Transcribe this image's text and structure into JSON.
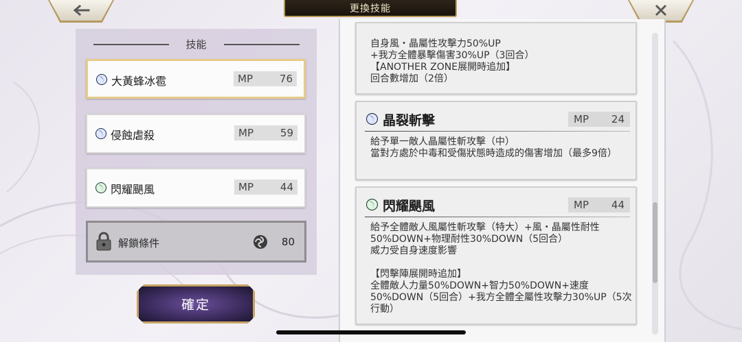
{
  "header": {
    "title": "更換技能",
    "back_icon": "back-arrow-icon",
    "close_icon": "close-icon"
  },
  "skills_panel": {
    "title": "技能",
    "skills": [
      {
        "name": "大黃蜂冰雹",
        "mp_label": "MP",
        "mp": "76",
        "icon": "crescent-slash-icon",
        "selected": true
      },
      {
        "name": "侵蝕虐殺",
        "mp_label": "MP",
        "mp": "59",
        "icon": "crescent-slash-icon",
        "selected": false
      },
      {
        "name": "閃耀颶風",
        "mp_label": "MP",
        "mp": "44",
        "icon": "wind-slash-icon",
        "selected": false
      }
    ],
    "locked": {
      "label": "解鎖條件",
      "icon": "lock-icon",
      "currency_icon": "swirl-icon",
      "cost": "80"
    },
    "confirm_label": "確定"
  },
  "details": [
    {
      "partial": true,
      "desc": "自身風・晶屬性攻擊力50%UP\n+我方全體暴擊傷害30%UP（3回合）\n【ANOTHER ZONE展開時追加】\n回合數增加（2倍）"
    },
    {
      "name": "晶裂斬擊",
      "mp_label": "MP",
      "mp": "24",
      "icon": "crescent-slash-icon",
      "desc": "給予單一敵人晶屬性斬攻擊（中）\n當對方處於中毒和受傷狀態時造成的傷害增加（最多9倍）"
    },
    {
      "name": "閃耀颶風",
      "mp_label": "MP",
      "mp": "44",
      "icon": "wind-slash-icon",
      "desc": "給予全體敵人風屬性斬攻擊（特大）+風・晶屬性耐性50%DOWN+物理耐性30%DOWN（5回合）\n威力受自身速度影響\n\n【閃擊陣展開時追加】\n全體敵人力量50%DOWN+智力50%DOWN+速度50%DOWN（5回合）+我方全體全屬性攻擊力30%UP（5次行動）"
    }
  ],
  "colors": {
    "selected_border": "#e6cc8a",
    "title_plate": "#1a140d",
    "confirm_button": "#3b2b5d",
    "gold_trim": "#c6a462"
  }
}
